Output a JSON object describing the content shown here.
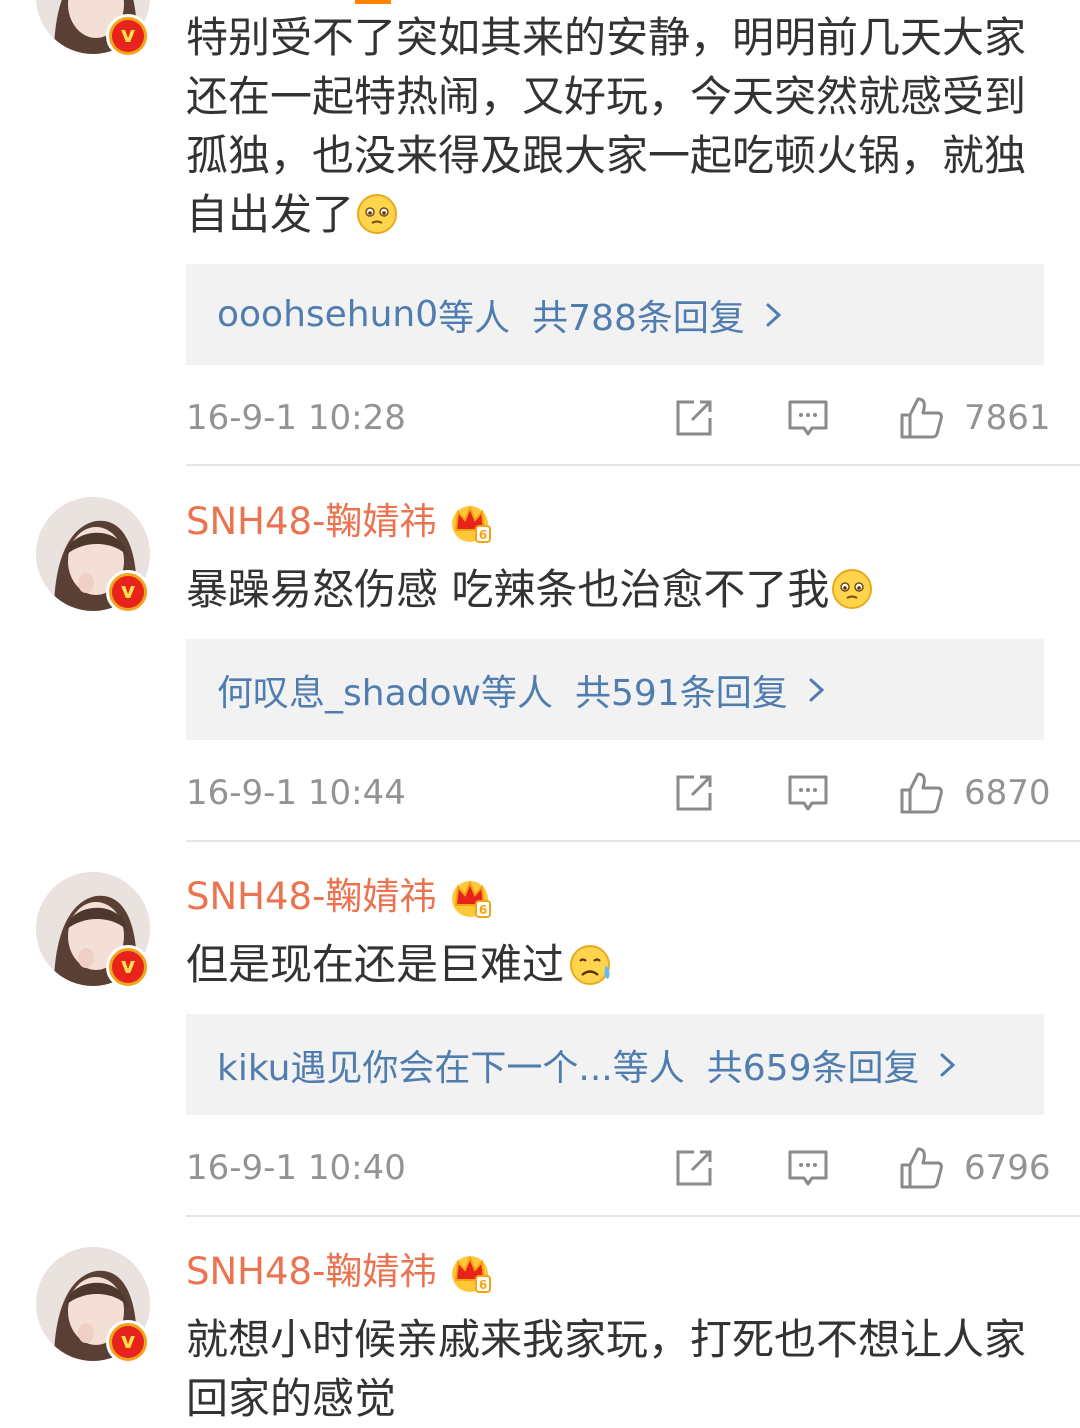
{
  "colors": {
    "accent": "#ff8200",
    "username": "#eb7350",
    "link": "#507daf",
    "text": "#333333",
    "meta": "#939393",
    "reply_bg": "#f2f2f2"
  },
  "comments": [
    {
      "username": "",
      "text": "特别受不了突如其来的安静，明明前几天大家还在一起特热闹，又好玩，今天突然就感受到孤独，也没来得及跟大家一起吃顿火锅，就独自出发了",
      "emoji": "sad-face-emoji",
      "replies": {
        "users": "ooohsehun0",
        "suffix": "等人",
        "count_label": "共788条回复"
      },
      "time": "16-9-1 10:28",
      "likes": "7861"
    },
    {
      "username": "SNH48-鞠婧祎",
      "text": "暴躁易怒伤感 吃辣条也治愈不了我",
      "emoji": "sad-face-emoji",
      "replies": {
        "users": "何叹息_shadow",
        "suffix": "等人",
        "count_label": "共591条回复"
      },
      "time": "16-9-1 10:44",
      "likes": "6870"
    },
    {
      "username": "SNH48-鞠婧祎",
      "text": "但是现在还是巨难过",
      "emoji": "crying-face-emoji",
      "replies": {
        "users": "kiku遇见你会在下一个...",
        "suffix": "等人",
        "count_label": "共659条回复"
      },
      "time": "16-9-1 10:40",
      "likes": "6796"
    },
    {
      "username": "SNH48-鞠婧祎",
      "text": "就想小时候亲戚来我家玩，打死也不想让人家回家的感觉",
      "emoji": "",
      "replies": null,
      "time": "",
      "likes": ""
    }
  ],
  "badge_letter": "v",
  "icons": {
    "verified": "verified-v-badge-icon",
    "member": "crown-member-icon",
    "repost": "repost-icon",
    "comment": "comment-icon",
    "like": "thumbs-up-icon",
    "more": "chevron-right-icon"
  }
}
